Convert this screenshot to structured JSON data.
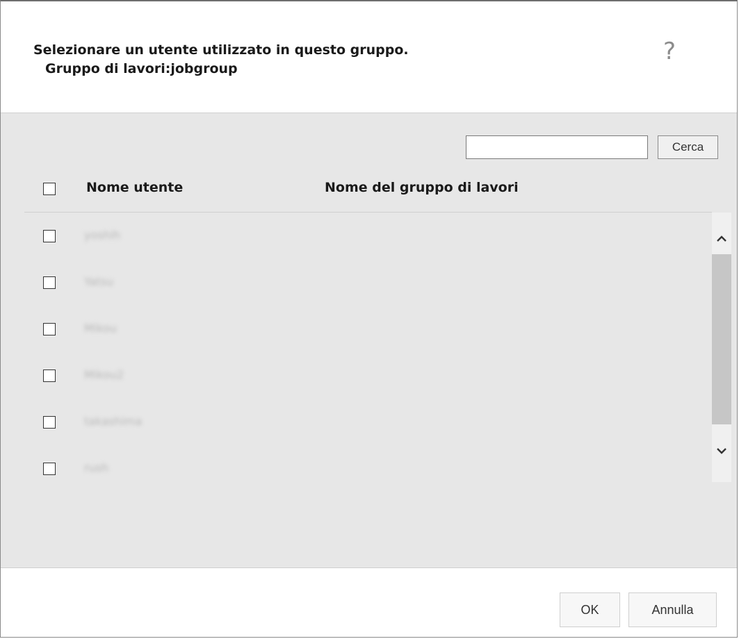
{
  "dialog": {
    "title_line1": "Selezionare un utente utilizzato in questo gruppo.",
    "title_line2": "Gruppo di lavori:jobgroup",
    "help_glyph": "?"
  },
  "search": {
    "value": "",
    "placeholder": "",
    "button_label": "Cerca"
  },
  "table": {
    "columns": [
      "Nome utente",
      "Nome del gruppo di lavori"
    ],
    "select_all_checked": false,
    "rows": [
      {
        "username": "yoshih",
        "group": "",
        "checked": false
      },
      {
        "username": "Yatsu",
        "group": "",
        "checked": false
      },
      {
        "username": "Mikou",
        "group": "",
        "checked": false
      },
      {
        "username": "Mikou2",
        "group": "",
        "checked": false
      },
      {
        "username": "takashima",
        "group": "",
        "checked": false
      },
      {
        "username": "rush",
        "group": "",
        "checked": false
      }
    ]
  },
  "footer": {
    "ok_label": "OK",
    "cancel_label": "Annulla"
  },
  "colors": {
    "body_background": "#e7e7e7",
    "header_background": "#ffffff",
    "scroll_thumb": "#c6c6c6"
  },
  "icons": [
    "help-icon",
    "scroll-up-icon",
    "scroll-down-icon"
  ]
}
